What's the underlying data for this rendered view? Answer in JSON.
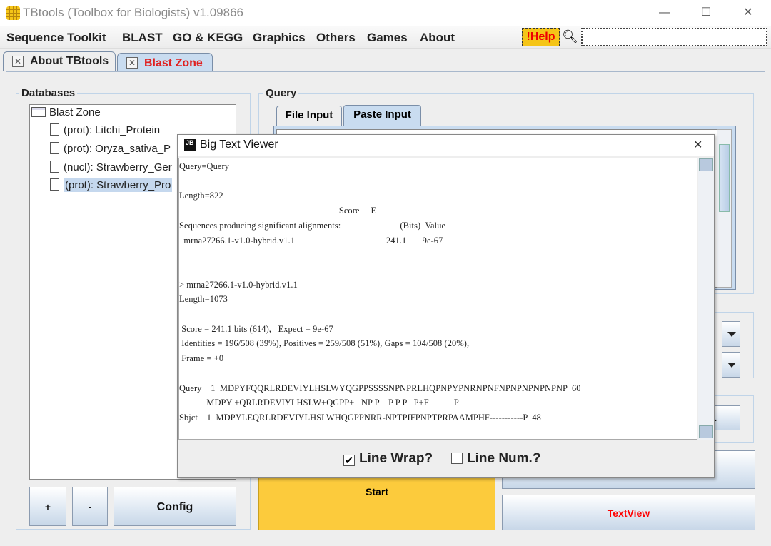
{
  "window": {
    "title": "TBtools (Toolbox for Biologists) v1.09866",
    "controls": [
      "—",
      "☐",
      "✕"
    ]
  },
  "menu": [
    "Sequence Toolkit",
    "BLAST",
    "GO & KEGG",
    "Graphics",
    "Others",
    "Games",
    "About"
  ],
  "help_label": "!Help",
  "search": {
    "value": "",
    "icon": "search-icon"
  },
  "tabs": [
    {
      "label": "About TBtools",
      "active": false
    },
    {
      "label": "Blast Zone",
      "active": true,
      "color": "#e02020"
    }
  ],
  "databases": {
    "title": "Databases",
    "root": "Blast Zone",
    "items": [
      "(prot): Litchi_Protein",
      "(prot): Oryza_sativa_P",
      "(nucl): Strawberry_Ger",
      "(prot): Strawberry_Pro"
    ],
    "selected_index": 3,
    "buttons": {
      "add": "+",
      "remove": "-",
      "config": "Config"
    }
  },
  "query": {
    "title": "Query",
    "tabs": [
      "File Input",
      "Paste Input"
    ],
    "active_tab": "Paste Input"
  },
  "browse_label": "...",
  "start_label": "Start",
  "textview_label": "TextView",
  "colors": {
    "start": "#fccb3c",
    "textview": "#ff0000",
    "selected": "#c5d8ee"
  },
  "dialog": {
    "title": "Big Text Viewer",
    "close": "✕",
    "lines": [
      "Query=Query",
      "",
      "Length=822",
      "                                                                      Score     E",
      "Sequences producing significant alignments:                          (Bits)  Value",
      "  mrna27266.1-v1.0-hybrid.v1.1                                        241.1       9e-67",
      "",
      "",
      "> mrna27266.1-v1.0-hybrid.v1.1",
      "Length=1073",
      "",
      " Score = 241.1 bits (614),   Expect = 9e-67",
      " Identities = 196/508 (39%), Positives = 259/508 (51%), Gaps = 104/508 (20%),",
      " Frame = +0",
      "",
      "Query    1  MDPYFQQRLRDEVIYLHSLWYQGPPSSSSNPNPRLHQPNPYPNRNPNFNPNPNPNPNPNP  60",
      "            MDPY +QRLRDEVIYLHSLW+QGPP+   NP P    P P P   P+F           P",
      "Sbjct    1  MDPYLEQRLRDEVIYLHSLWHQGPPNRR-NPTPIFPNPTPRPAAMPHF-----------P  48"
    ],
    "line_wrap": {
      "label": "Line Wrap?",
      "checked": true
    },
    "line_num": {
      "label": "Line Num.?",
      "checked": false
    }
  }
}
